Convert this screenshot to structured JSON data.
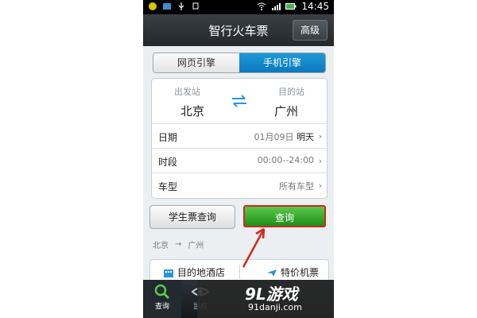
{
  "status_bar": {
    "time": "14:45"
  },
  "header": {
    "title": "智行火车票",
    "advanced_button": "高级"
  },
  "mode_tabs": {
    "web": "网页引擎",
    "mobile": "手机引擎"
  },
  "stations": {
    "from_label": "出发站",
    "from_city": "北京",
    "to_label": "目的站",
    "to_city": "广州"
  },
  "fields": {
    "date": {
      "label": "日期",
      "value": "01月09日",
      "day": "明天"
    },
    "time": {
      "label": "时段",
      "value": "00:00--24:00"
    },
    "type": {
      "label": "车型",
      "value": "所有车型"
    }
  },
  "buttons": {
    "student": "学生票查询",
    "query": "查询"
  },
  "history": {
    "from": "北京",
    "arrow": "→",
    "to": "广州"
  },
  "bottom_links": {
    "hotel": "目的地酒店",
    "flight": "特价机票"
  },
  "tabbar": {
    "query": "查询",
    "monitor": "监控"
  },
  "watermark": {
    "logo": "9L游戏",
    "url": "91danji.com"
  },
  "colors": {
    "accent_blue": "#0a78bd",
    "query_green": "#1e8f1a",
    "highlight_red": "#cc2a1f"
  }
}
